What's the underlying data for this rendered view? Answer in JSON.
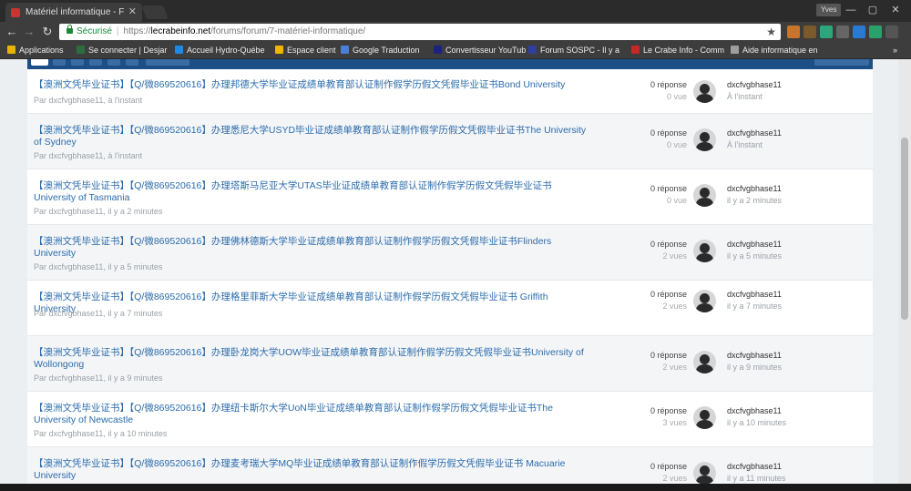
{
  "browser": {
    "tab_title": "Matériel informatique - F",
    "tab_close": "✕",
    "user_name": "Yves",
    "window_controls": [
      "—",
      "▢",
      "✕"
    ],
    "nav_back": "←",
    "nav_forward": "→",
    "nav_reload": "↻",
    "secure_label": "Sécurisé",
    "url_scheme": "https://",
    "url_host": "lecrabeinfo.net",
    "url_path": "/forums/forum/7-matériel-informatique/",
    "bookmark_icon": "★",
    "overflow": "»",
    "extension_colors": [
      "#c8742a",
      "#7a5a2a",
      "#2ea57b",
      "#666666",
      "#2a7ad1",
      "#2aa06a",
      "#555555"
    ]
  },
  "bookmarks": [
    {
      "label": "Applications",
      "color": "#e9b400"
    },
    {
      "label": "Se connecter | Desjar",
      "color": "#2a6e3f"
    },
    {
      "label": "Accueil Hydro-Québe",
      "color": "#1e88e5"
    },
    {
      "label": "Espace client",
      "color": "#f2b600"
    },
    {
      "label": "Google Traduction",
      "color": "#4a7fd6"
    },
    {
      "label": "Convertisseur YouTub",
      "color": "#1a237e"
    },
    {
      "label": "Forum SOSPC - Il y a",
      "color": "#303f9f"
    },
    {
      "label": "Le Crabe Info - Comm",
      "color": "#c62828"
    },
    {
      "label": "Aide informatique en",
      "color": "#9e9e9e"
    }
  ],
  "topics": [
    {
      "title": "【澳洲文凭毕业证书】【Q/微869520616】办理邦德大学毕业证成绩单教育部认证制作假学历假文凭假毕业证书Bond University",
      "author_line": "Par dxcfvgbhase11, à l'instant",
      "replies": "0 réponse",
      "views": "0 vue",
      "last_user": "dxcfvgbhase11",
      "last_time": "À l'instant"
    },
    {
      "title": "【澳洲文凭毕业证书】【Q/微869520616】办理悉尼大学USYD毕业证成绩单教育部认证制作假学历假文凭假毕业证书The University of Sydney",
      "author_line": "Par dxcfvgbhase11, à l'instant",
      "replies": "0 réponse",
      "views": "0 vue",
      "last_user": "dxcfvgbhase11",
      "last_time": "À l'instant"
    },
    {
      "title": "【澳洲文凭毕业证书】【Q/微869520616】办理塔斯马尼亚大学UTAS毕业证成绩单教育部认证制作假学历假文凭假毕业证书University of Tasmania",
      "author_line": "Par dxcfvgbhase11, il y a 2 minutes",
      "replies": "0 réponse",
      "views": "0 vue",
      "last_user": "dxcfvgbhase11",
      "last_time": "il y a 2 minutes"
    },
    {
      "title": "【澳洲文凭毕业证书】【Q/微869520616】办理佛林德斯大学毕业证成绩单教育部认证制作假学历假文凭假毕业证书Flinders University",
      "author_line": "Par dxcfvgbhase11, il y a 5 minutes",
      "replies": "0 réponse",
      "views": "2 vues",
      "last_user": "dxcfvgbhase11",
      "last_time": "il y a 5 minutes"
    },
    {
      "title": "【澳洲文凭毕业证书】【Q/微869520616】办理格里菲斯大学毕业证成绩单教育部认证制作假学历假文凭假毕业证书 Griffith University",
      "author_line": "Par dxcfvgbhase11, il y a 7 minutes",
      "replies": "0 réponse",
      "views": "2 vues",
      "last_user": "dxcfvgbhase11",
      "last_time": "il y a 7 minutes"
    },
    {
      "title": "【澳洲文凭毕业证书】【Q/微869520616】办理卧龙岗大学UOW毕业证成绩单教育部认证制作假学历假文凭假毕业证书University of Wollongong",
      "author_line": "Par dxcfvgbhase11, il y a 9 minutes",
      "replies": "0 réponse",
      "views": "2 vues",
      "last_user": "dxcfvgbhase11",
      "last_time": "il y a 9 minutes"
    },
    {
      "title": "【澳洲文凭毕业证书】【Q/微869520616】办理纽卡斯尔大学UoN毕业证成绩单教育部认证制作假学历假文凭假毕业证书The University of Newcastle",
      "author_line": "Par dxcfvgbhase11, il y a 10 minutes",
      "replies": "0 réponse",
      "views": "3 vues",
      "last_user": "dxcfvgbhase11",
      "last_time": "il y a 10 minutes"
    },
    {
      "title": "【澳洲文凭毕业证书】【Q/微869520616】办理麦考瑞大学MQ毕业证成绩单教育部认证制作假学历假文凭假毕业证书 Macuarie University",
      "author_line": "Par dxcfvgbhase11, il y a 11 minutes",
      "replies": "0 réponse",
      "views": "2 vues",
      "last_user": "dxcfvgbhase11",
      "last_time": "il y a 11 minutes"
    }
  ]
}
